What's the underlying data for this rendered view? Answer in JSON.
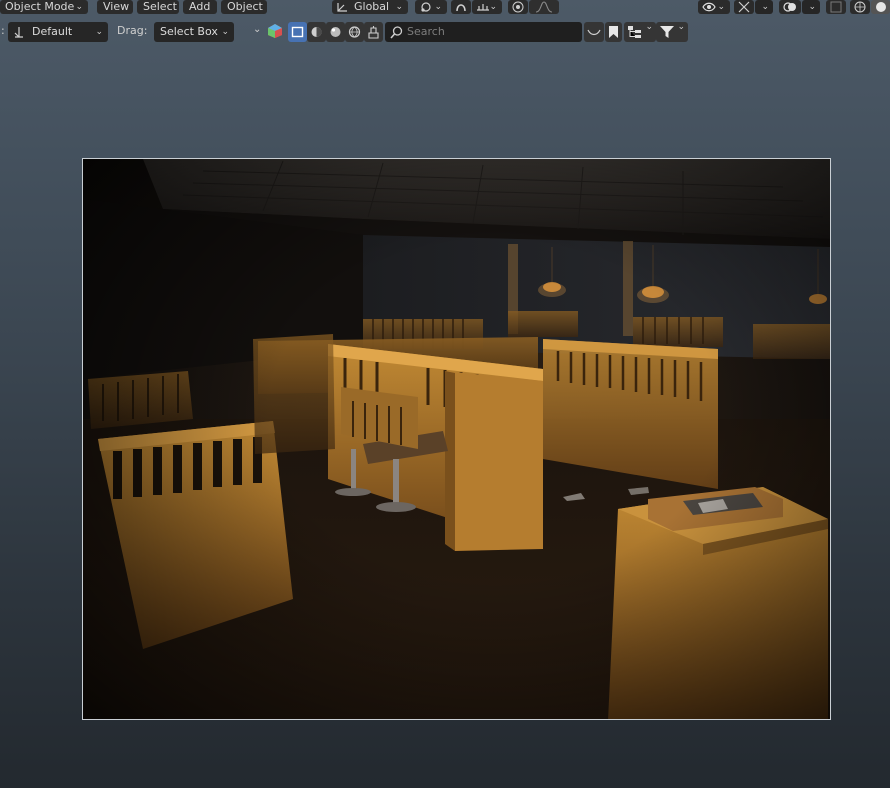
{
  "header": {
    "mode_label": "Object Mode",
    "menu": [
      "View",
      "Select",
      "Add",
      "Object"
    ],
    "orientation_label": "Global",
    "transform_prefix": ":",
    "transform_orientation": "Default",
    "drag_label": "Drag:",
    "drag_value": "Select Box",
    "search_placeholder": "Search"
  },
  "colors": {
    "accent": "#4772b3",
    "header_bg": "#2b2b2b",
    "frame_border": "#c9cfd4",
    "wood": "#b7822f"
  },
  "icons": {
    "row1": [
      "transform-pivot-icon",
      "snap-icon",
      "snap-increment-icon",
      "proportional-edit-icon",
      "falloff-icon",
      "visibility-icon",
      "gizmo-icon",
      "overlay-icon",
      "xray-icon",
      "wireframe-shading-icon",
      "solid-shading-icon"
    ],
    "row2": [
      "color-wheel-icon",
      "select-mode-icon",
      "shading-icon",
      "material-icon",
      "render-icon",
      "filter-icon",
      "bookmark-icon",
      "collection-icon"
    ]
  }
}
